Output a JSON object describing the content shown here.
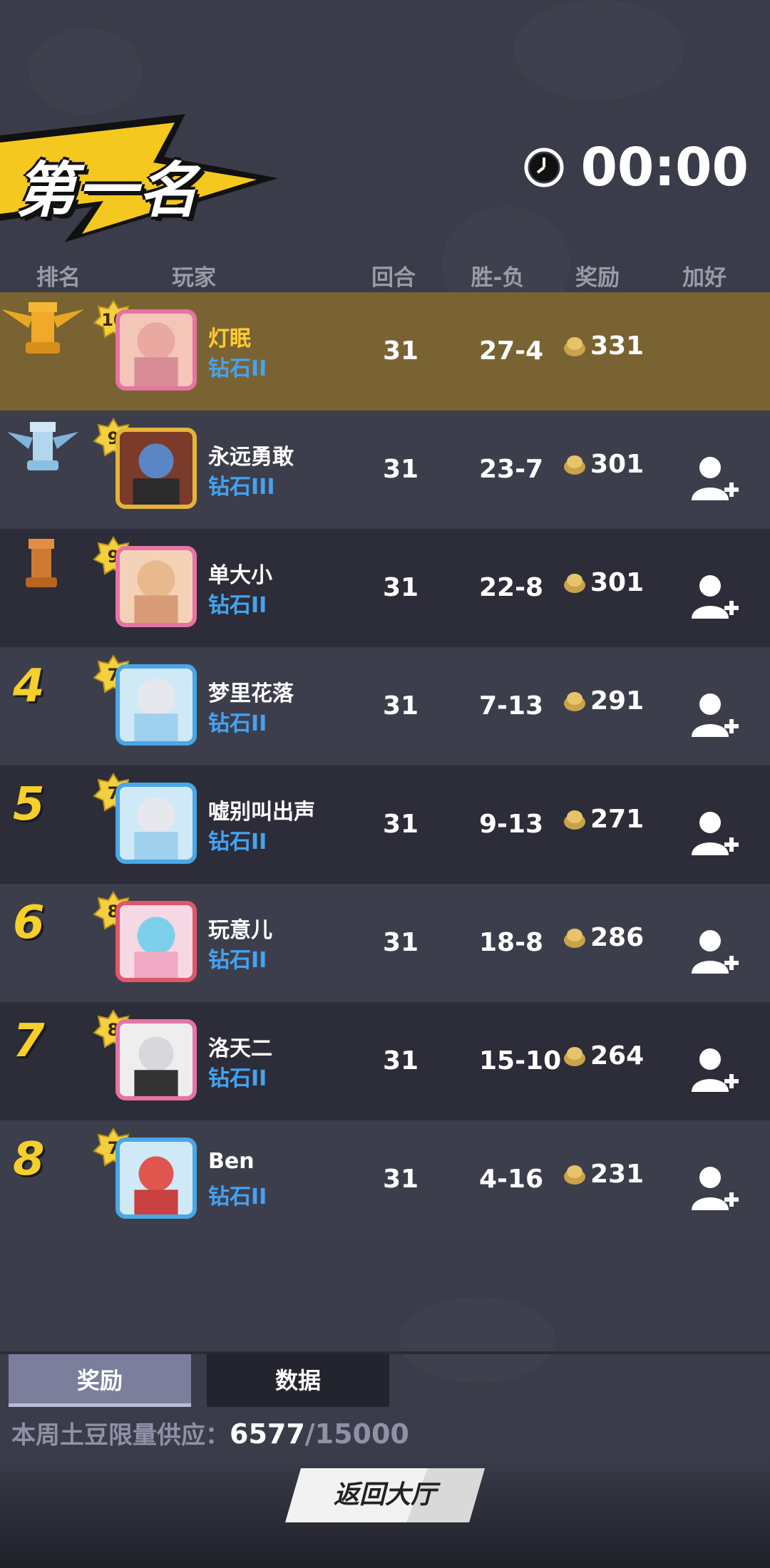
{
  "header": {
    "title": "第一名",
    "timer": "00:00"
  },
  "columns": {
    "rank": "排名",
    "player": "玩家",
    "rounds": "回合",
    "record": "胜-负",
    "reward": "奖励",
    "add_friend": "加好友"
  },
  "rows": [
    {
      "rank": "1",
      "rank_icon": "gold-rook-winged-icon",
      "level": "10",
      "name": "灯眠",
      "tier": "钻石II",
      "rounds": "31",
      "record": "27-4",
      "reward": "331",
      "frame": "pink",
      "add_friend": false
    },
    {
      "rank": "2",
      "rank_icon": "silver-rook-winged-icon",
      "level": "9",
      "name": "永远勇敢",
      "tier": "钻石III",
      "rounds": "31",
      "record": "23-7",
      "reward": "301",
      "frame": "gold",
      "add_friend": true
    },
    {
      "rank": "3",
      "rank_icon": "bronze-rook-icon",
      "level": "9",
      "name": "单大小",
      "tier": "钻石II",
      "rounds": "31",
      "record": "22-8",
      "reward": "301",
      "frame": "pink",
      "add_friend": true
    },
    {
      "rank": "4",
      "level": "7",
      "name": "梦里花落",
      "tier": "钻石II",
      "rounds": "31",
      "record": "7-13",
      "reward": "291",
      "frame": "blue",
      "add_friend": true
    },
    {
      "rank": "5",
      "level": "7",
      "name": "嘘别叫出声",
      "tier": "钻石II",
      "rounds": "31",
      "record": "9-13",
      "reward": "271",
      "frame": "blue",
      "add_friend": true
    },
    {
      "rank": "6",
      "level": "8",
      "name": "玩意儿",
      "tier": "钻石II",
      "rounds": "31",
      "record": "18-8",
      "reward": "286",
      "frame": "red",
      "add_friend": true
    },
    {
      "rank": "7",
      "level": "8",
      "name": "洛天二",
      "tier": "钻石II",
      "rounds": "31",
      "record": "15-10",
      "reward": "264",
      "frame": "pink",
      "add_friend": true
    },
    {
      "rank": "8",
      "level": "7",
      "name": "Ben",
      "tier": "钻石II",
      "rounds": "31",
      "record": "4-16",
      "reward": "231",
      "frame": "blue",
      "add_friend": true
    }
  ],
  "tabs": {
    "reward": "奖励",
    "data": "数据"
  },
  "supply": {
    "label": "本周土豆限量供应：",
    "current": "6577",
    "max": "/15000"
  },
  "back_button": "返回大厅",
  "colors": {
    "background": "#3b3c4a",
    "first_row": "#7a6333",
    "rank_yellow": "#f6cf2a",
    "tier_blue": "#44a3f2"
  }
}
